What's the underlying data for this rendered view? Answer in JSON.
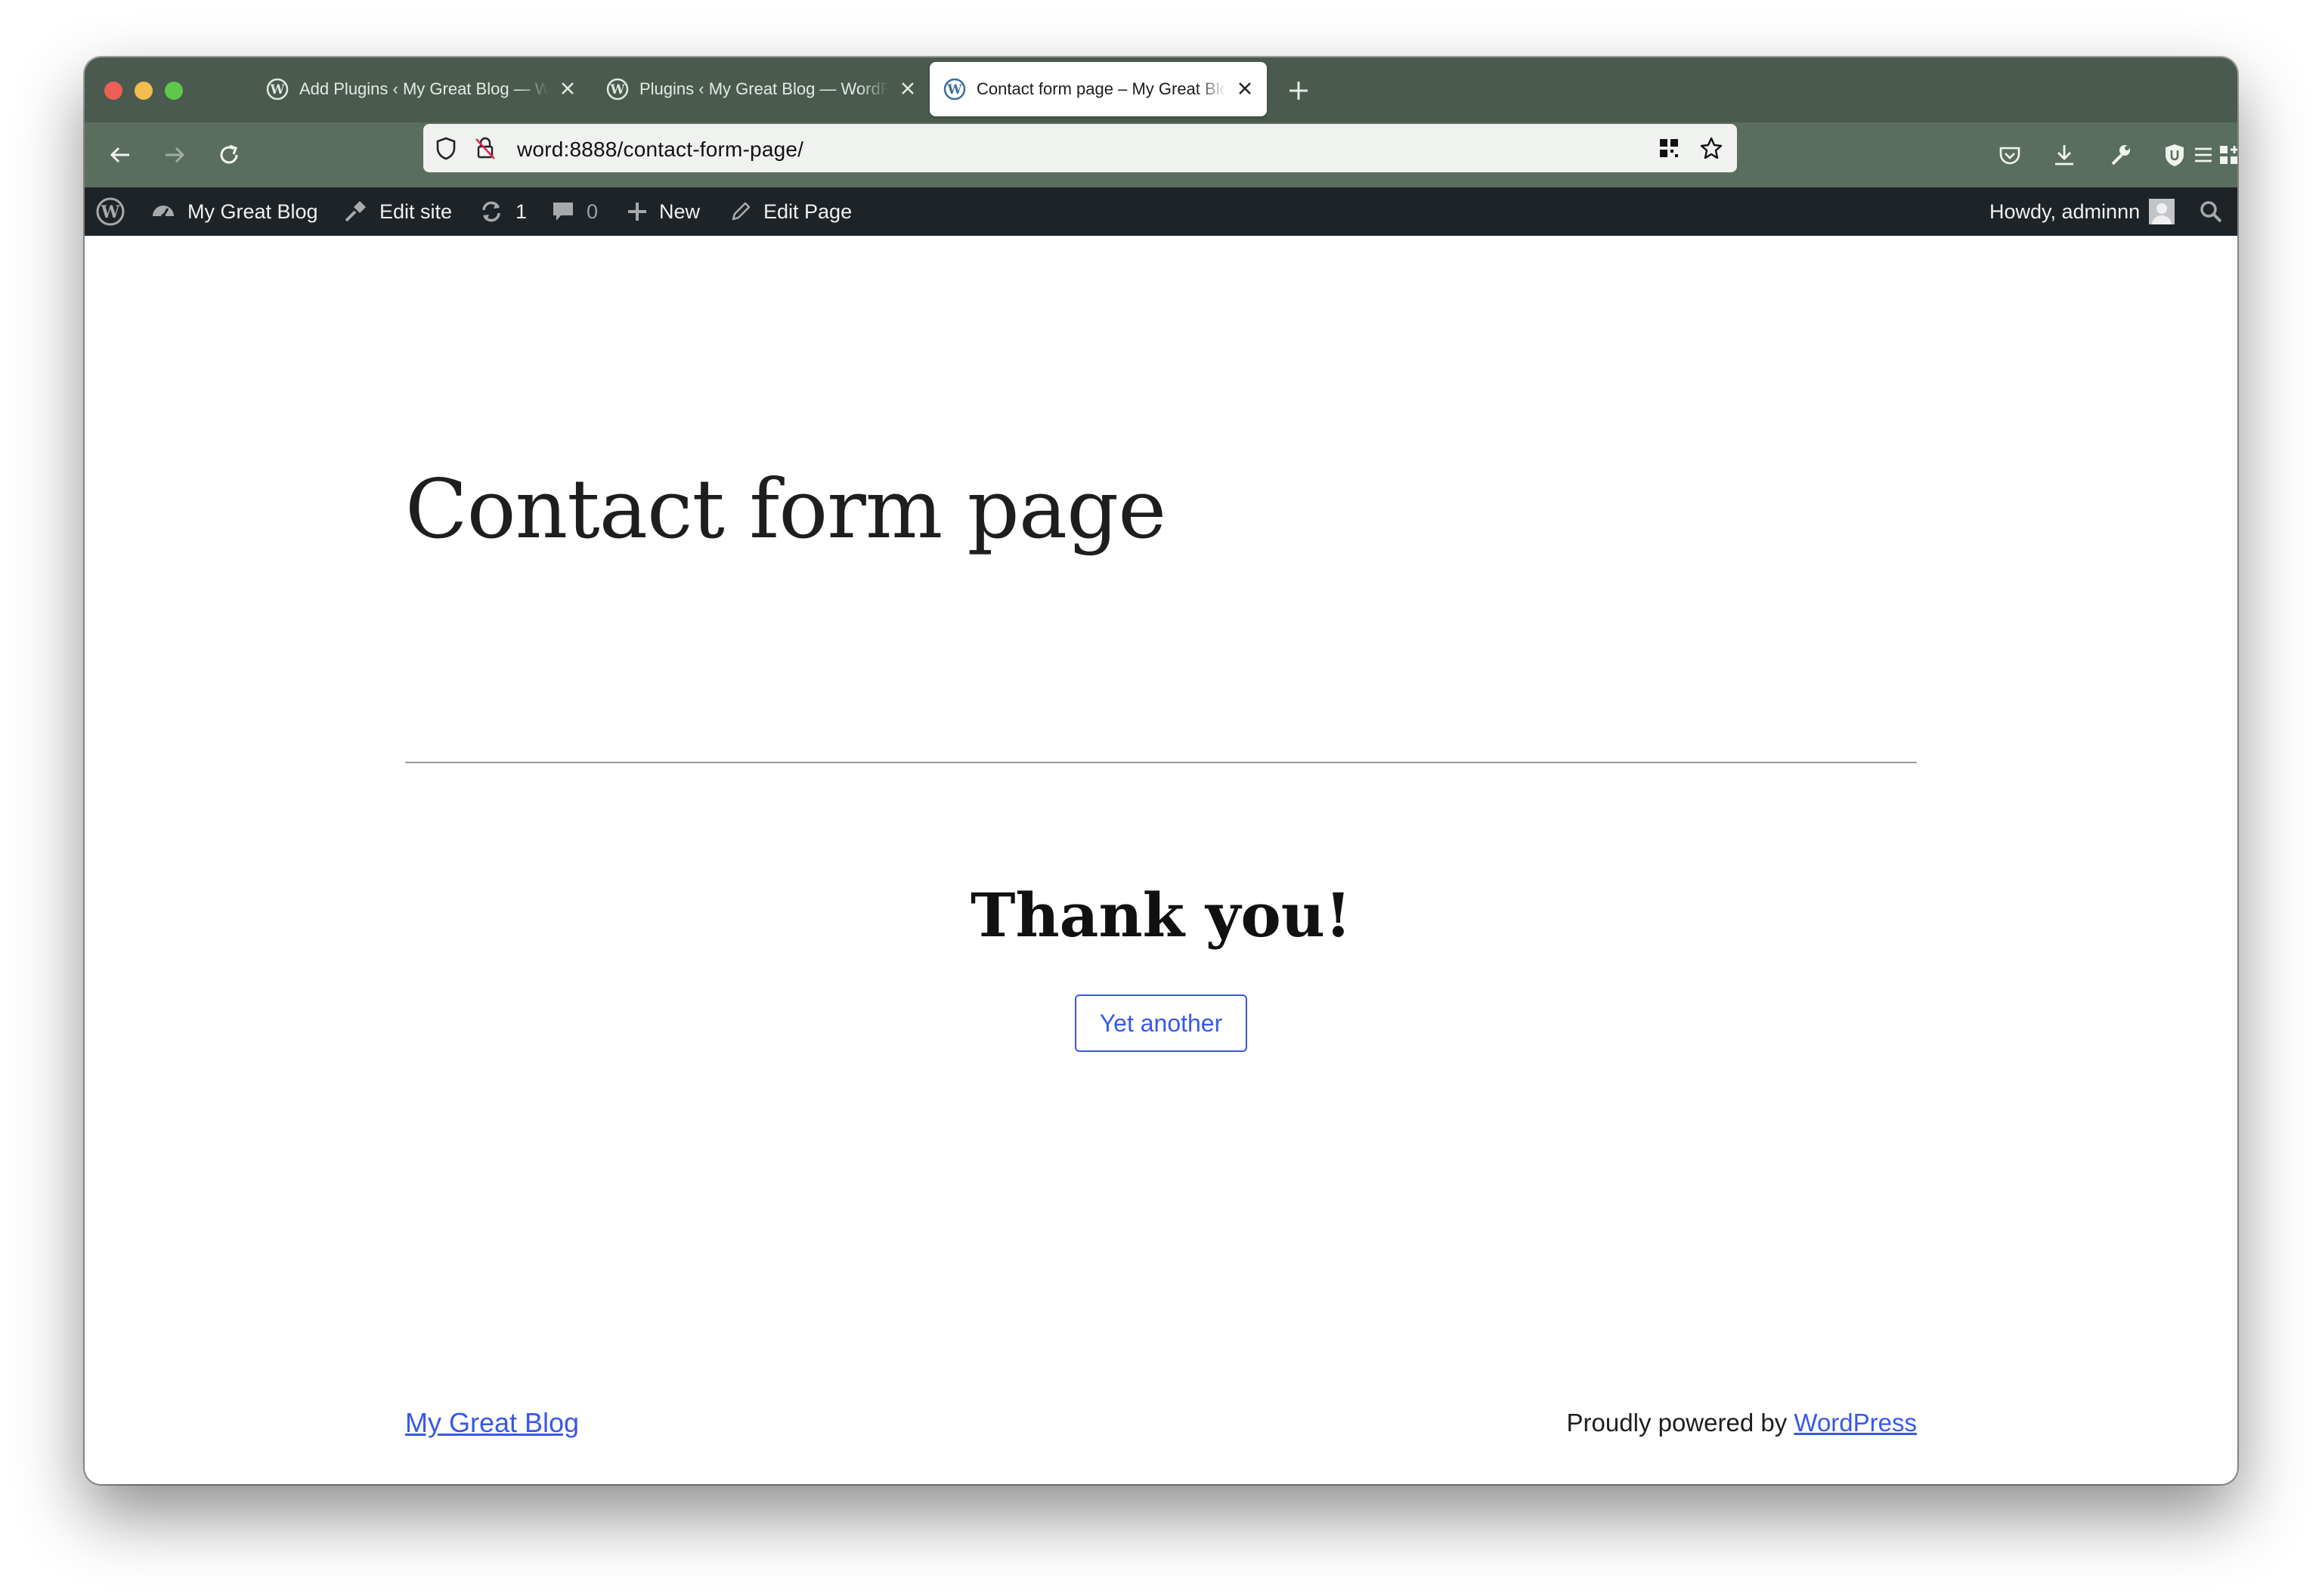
{
  "browser": {
    "tabs": [
      {
        "title": "Add Plugins ‹ My Great Blog — WordPress",
        "active": false
      },
      {
        "title": "Plugins ‹ My Great Blog — WordPress",
        "active": false
      },
      {
        "title": "Contact form page – My Great Blog",
        "active": true
      }
    ],
    "url": "word:8888/contact-form-page/",
    "icons": [
      "back-icon",
      "forward-icon",
      "reload-icon",
      "shield-icon",
      "insecure-lock-icon",
      "qr-code-icon",
      "bookmark-star-icon",
      "pocket-icon",
      "download-icon",
      "wrench-icon",
      "ublock-icon",
      "extensions-icon",
      "menu-icon",
      "new-tab-icon",
      "close-tab-icon",
      "wordpress-favicon"
    ]
  },
  "adminbar": {
    "site_name": "My Great Blog",
    "edit_site": "Edit site",
    "updates_count": "1",
    "comments_count": "0",
    "new_label": "New",
    "edit_page": "Edit Page",
    "howdy": "Howdy, adminnn"
  },
  "page": {
    "title": "Contact form page",
    "thanks": "Thank you!",
    "button": "Yet another"
  },
  "footer": {
    "site_link": "My Great Blog",
    "powered_prefix": "Proudly powered by",
    "powered_link": "WordPress"
  },
  "colors": {
    "tabstrip": "#4a5a4e",
    "toolbar": "#5a6e5f",
    "adminbar": "#1d2327",
    "accent": "#3858e9"
  }
}
